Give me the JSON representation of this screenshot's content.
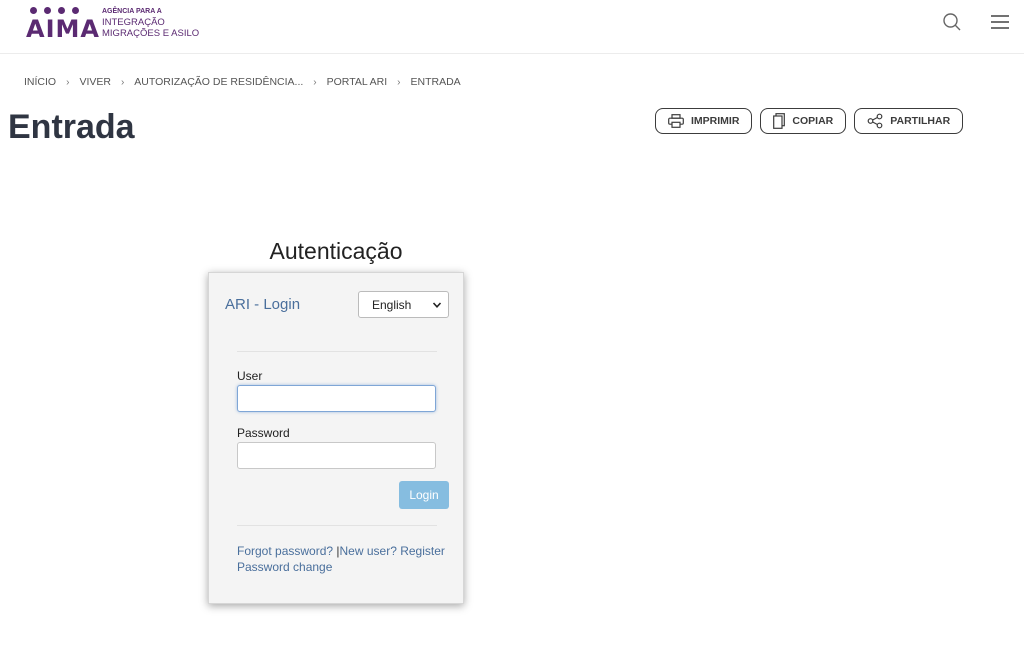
{
  "header": {
    "logo_word": "AIMA",
    "logo_line1": "AGÊNCIA PARA A",
    "logo_line2": "INTEGRAÇÃO",
    "logo_line3": "MIGRAÇÕES E ASILO",
    "search_icon": "search-icon",
    "menu_icon": "hamburger-menu-icon"
  },
  "breadcrumb": [
    "INÍCIO",
    "VIVER",
    "AUTORIZAÇÃO DE RESIDÊNCIA...",
    "PORTAL ARI",
    "ENTRADA"
  ],
  "page": {
    "title": "Entrada",
    "actions": {
      "print": "IMPRIMIR",
      "copy": "COPIAR",
      "share": "PARTILHAR"
    }
  },
  "auth": {
    "heading": "Autenticação",
    "panel_title": "ARI - Login",
    "language_selected": "English",
    "user_label": "User",
    "user_value": "",
    "password_label": "Password",
    "password_value": "",
    "login_button": "Login",
    "forgot_link": "Forgot password?",
    "separator": "|",
    "register_link": "New user? Register",
    "password_change_link": "Password change"
  },
  "colors": {
    "brand": "#5b2a72",
    "link": "#4a6f9c",
    "login_button": "#86bde0"
  }
}
